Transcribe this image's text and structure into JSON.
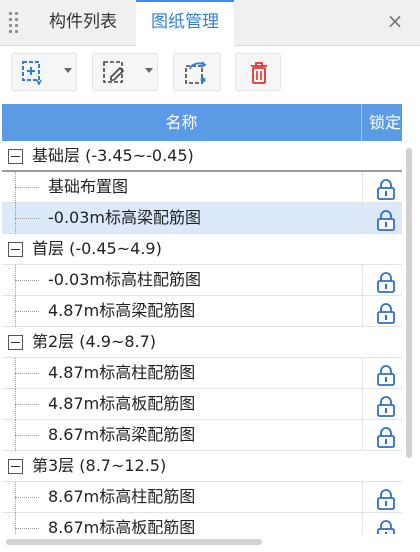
{
  "tabs": [
    {
      "label": "构件列表",
      "active": false
    },
    {
      "label": "图纸管理",
      "active": true
    }
  ],
  "close_glyph": "×",
  "toolbar": {
    "buttons": [
      {
        "icon": "add-drawing-icon",
        "has_dropdown": true
      },
      {
        "icon": "edit-drawing-icon",
        "has_dropdown": true
      },
      {
        "icon": "export-drawing-icon",
        "has_dropdown": false
      },
      {
        "icon": "delete-icon",
        "has_dropdown": false
      }
    ]
  },
  "table": {
    "headers": {
      "name": "名称",
      "lock": "锁定"
    },
    "rows": [
      {
        "kind": "group",
        "label": "基础层 (-3.45~-0.45)"
      },
      {
        "kind": "item",
        "label": "基础布置图",
        "locked": true
      },
      {
        "kind": "item",
        "label": "-0.03m标高梁配筋图",
        "locked": true,
        "selected": true
      },
      {
        "kind": "group",
        "label": "首层 (-0.45~4.9)"
      },
      {
        "kind": "item",
        "label": "-0.03m标高柱配筋图",
        "locked": true
      },
      {
        "kind": "item",
        "label": "4.87m标高梁配筋图",
        "locked": true
      },
      {
        "kind": "group",
        "label": "第2层 (4.9~8.7)"
      },
      {
        "kind": "item",
        "label": "4.87m标高柱配筋图",
        "locked": true
      },
      {
        "kind": "item",
        "label": "4.87m标高板配筋图",
        "locked": true
      },
      {
        "kind": "item",
        "label": "8.67m标高梁配筋图",
        "locked": true
      },
      {
        "kind": "group",
        "label": "第3层 (8.7~12.5)"
      },
      {
        "kind": "item",
        "label": "8.67m标高柱配筋图",
        "locked": true
      },
      {
        "kind": "item",
        "label": "8.67m标高板配筋图",
        "locked": true
      }
    ]
  },
  "colors": {
    "accent": "#3b8ef0",
    "header_bg": "#5b9be6",
    "selected_row": "#dbe9fb"
  }
}
